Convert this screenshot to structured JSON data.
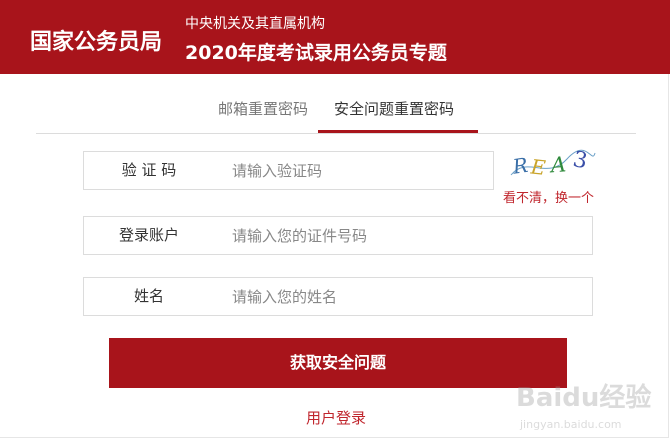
{
  "header": {
    "brand": "国家公务员局",
    "subtitle_line1": "中央机关及其直属机构",
    "subtitle_line2": "2020年度考试录用公务员专题"
  },
  "tabs": [
    {
      "label": "邮箱重置密码",
      "active": false
    },
    {
      "label": "安全问题重置密码",
      "active": true
    }
  ],
  "form": {
    "captcha": {
      "label": "验 证 码",
      "placeholder": "请输入验证码",
      "value": ""
    },
    "account": {
      "label": "登录账户",
      "placeholder": "请输入您的证件号码",
      "value": ""
    },
    "name": {
      "label": "姓名",
      "placeholder": "请输入您的姓名",
      "value": ""
    },
    "captcha_text": "REA3",
    "captcha_refresh": "看不清，换一个",
    "submit_label": "获取安全问题",
    "login_link": "用户登录"
  },
  "watermark": {
    "text": "Baidu经验",
    "url_text": "jingyan.baidu.com"
  },
  "colors": {
    "brand_red": "#a8141b",
    "link_red": "#c0262d",
    "border": "#dcdcdc"
  }
}
